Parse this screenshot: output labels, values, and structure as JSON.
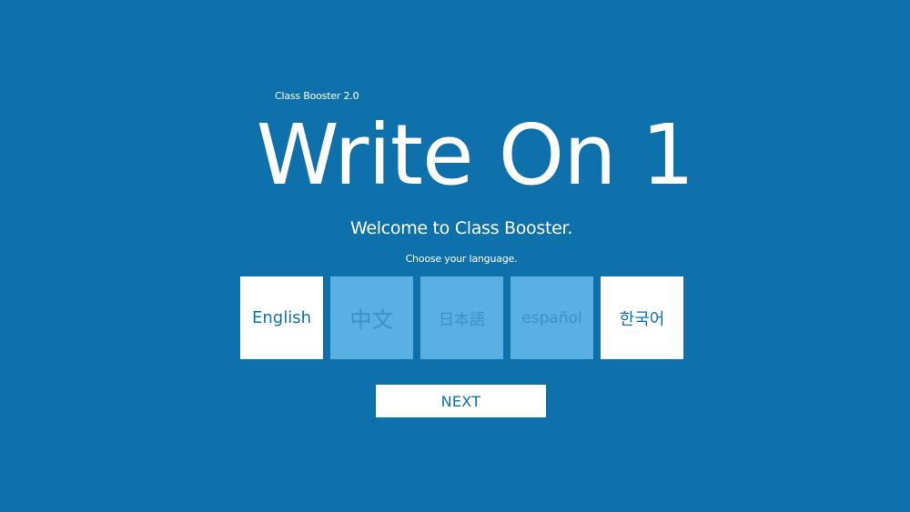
{
  "app": {
    "subtitle": "Class Booster 2.0",
    "title": "Write On 1"
  },
  "intro": {
    "welcome": "Welcome to Class Booster.",
    "prompt": "Choose your language."
  },
  "languages": [
    {
      "label": "English",
      "state": "selected"
    },
    {
      "label": "中文",
      "state": "unselected"
    },
    {
      "label": "日本語",
      "state": "unselected"
    },
    {
      "label": "español",
      "state": "unselected"
    },
    {
      "label": "한국어",
      "state": "selected"
    }
  ],
  "actions": {
    "next_label": "NEXT"
  },
  "colors": {
    "background": "#0f71ab",
    "tile_selected": "#ffffff",
    "tile_unselected": "#5ab0e2",
    "text_on_tile": "#0f71ab"
  }
}
